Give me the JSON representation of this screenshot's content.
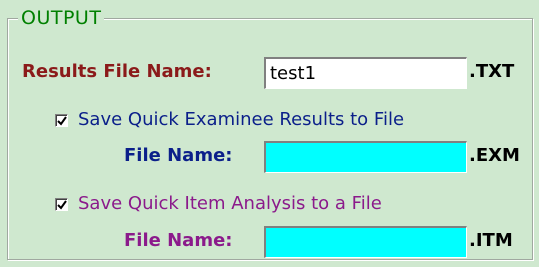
{
  "group": {
    "title": "OUTPUT"
  },
  "results": {
    "label": "Results File Name:",
    "value": "test1",
    "extension": ".TXT"
  },
  "examinee": {
    "checkbox_label": "Save Quick Examinee Results to File",
    "checked": true,
    "field_label": "File Name:",
    "value": "",
    "extension": ".EXM"
  },
  "item_analysis": {
    "checkbox_label": "Save Quick Item Analysis to a File",
    "checked": true,
    "field_label": "File Name:",
    "value": "",
    "extension": ".ITM"
  },
  "icons": {
    "checkbox_mark": "checkmark-icon"
  },
  "colors": {
    "background": "#cfe8cf",
    "title": "#008000",
    "results_label": "#8b1a1a",
    "examinee_text": "#0b1f8a",
    "item_text": "#8b1a8b",
    "filename_field_fill": "#00ffff"
  }
}
